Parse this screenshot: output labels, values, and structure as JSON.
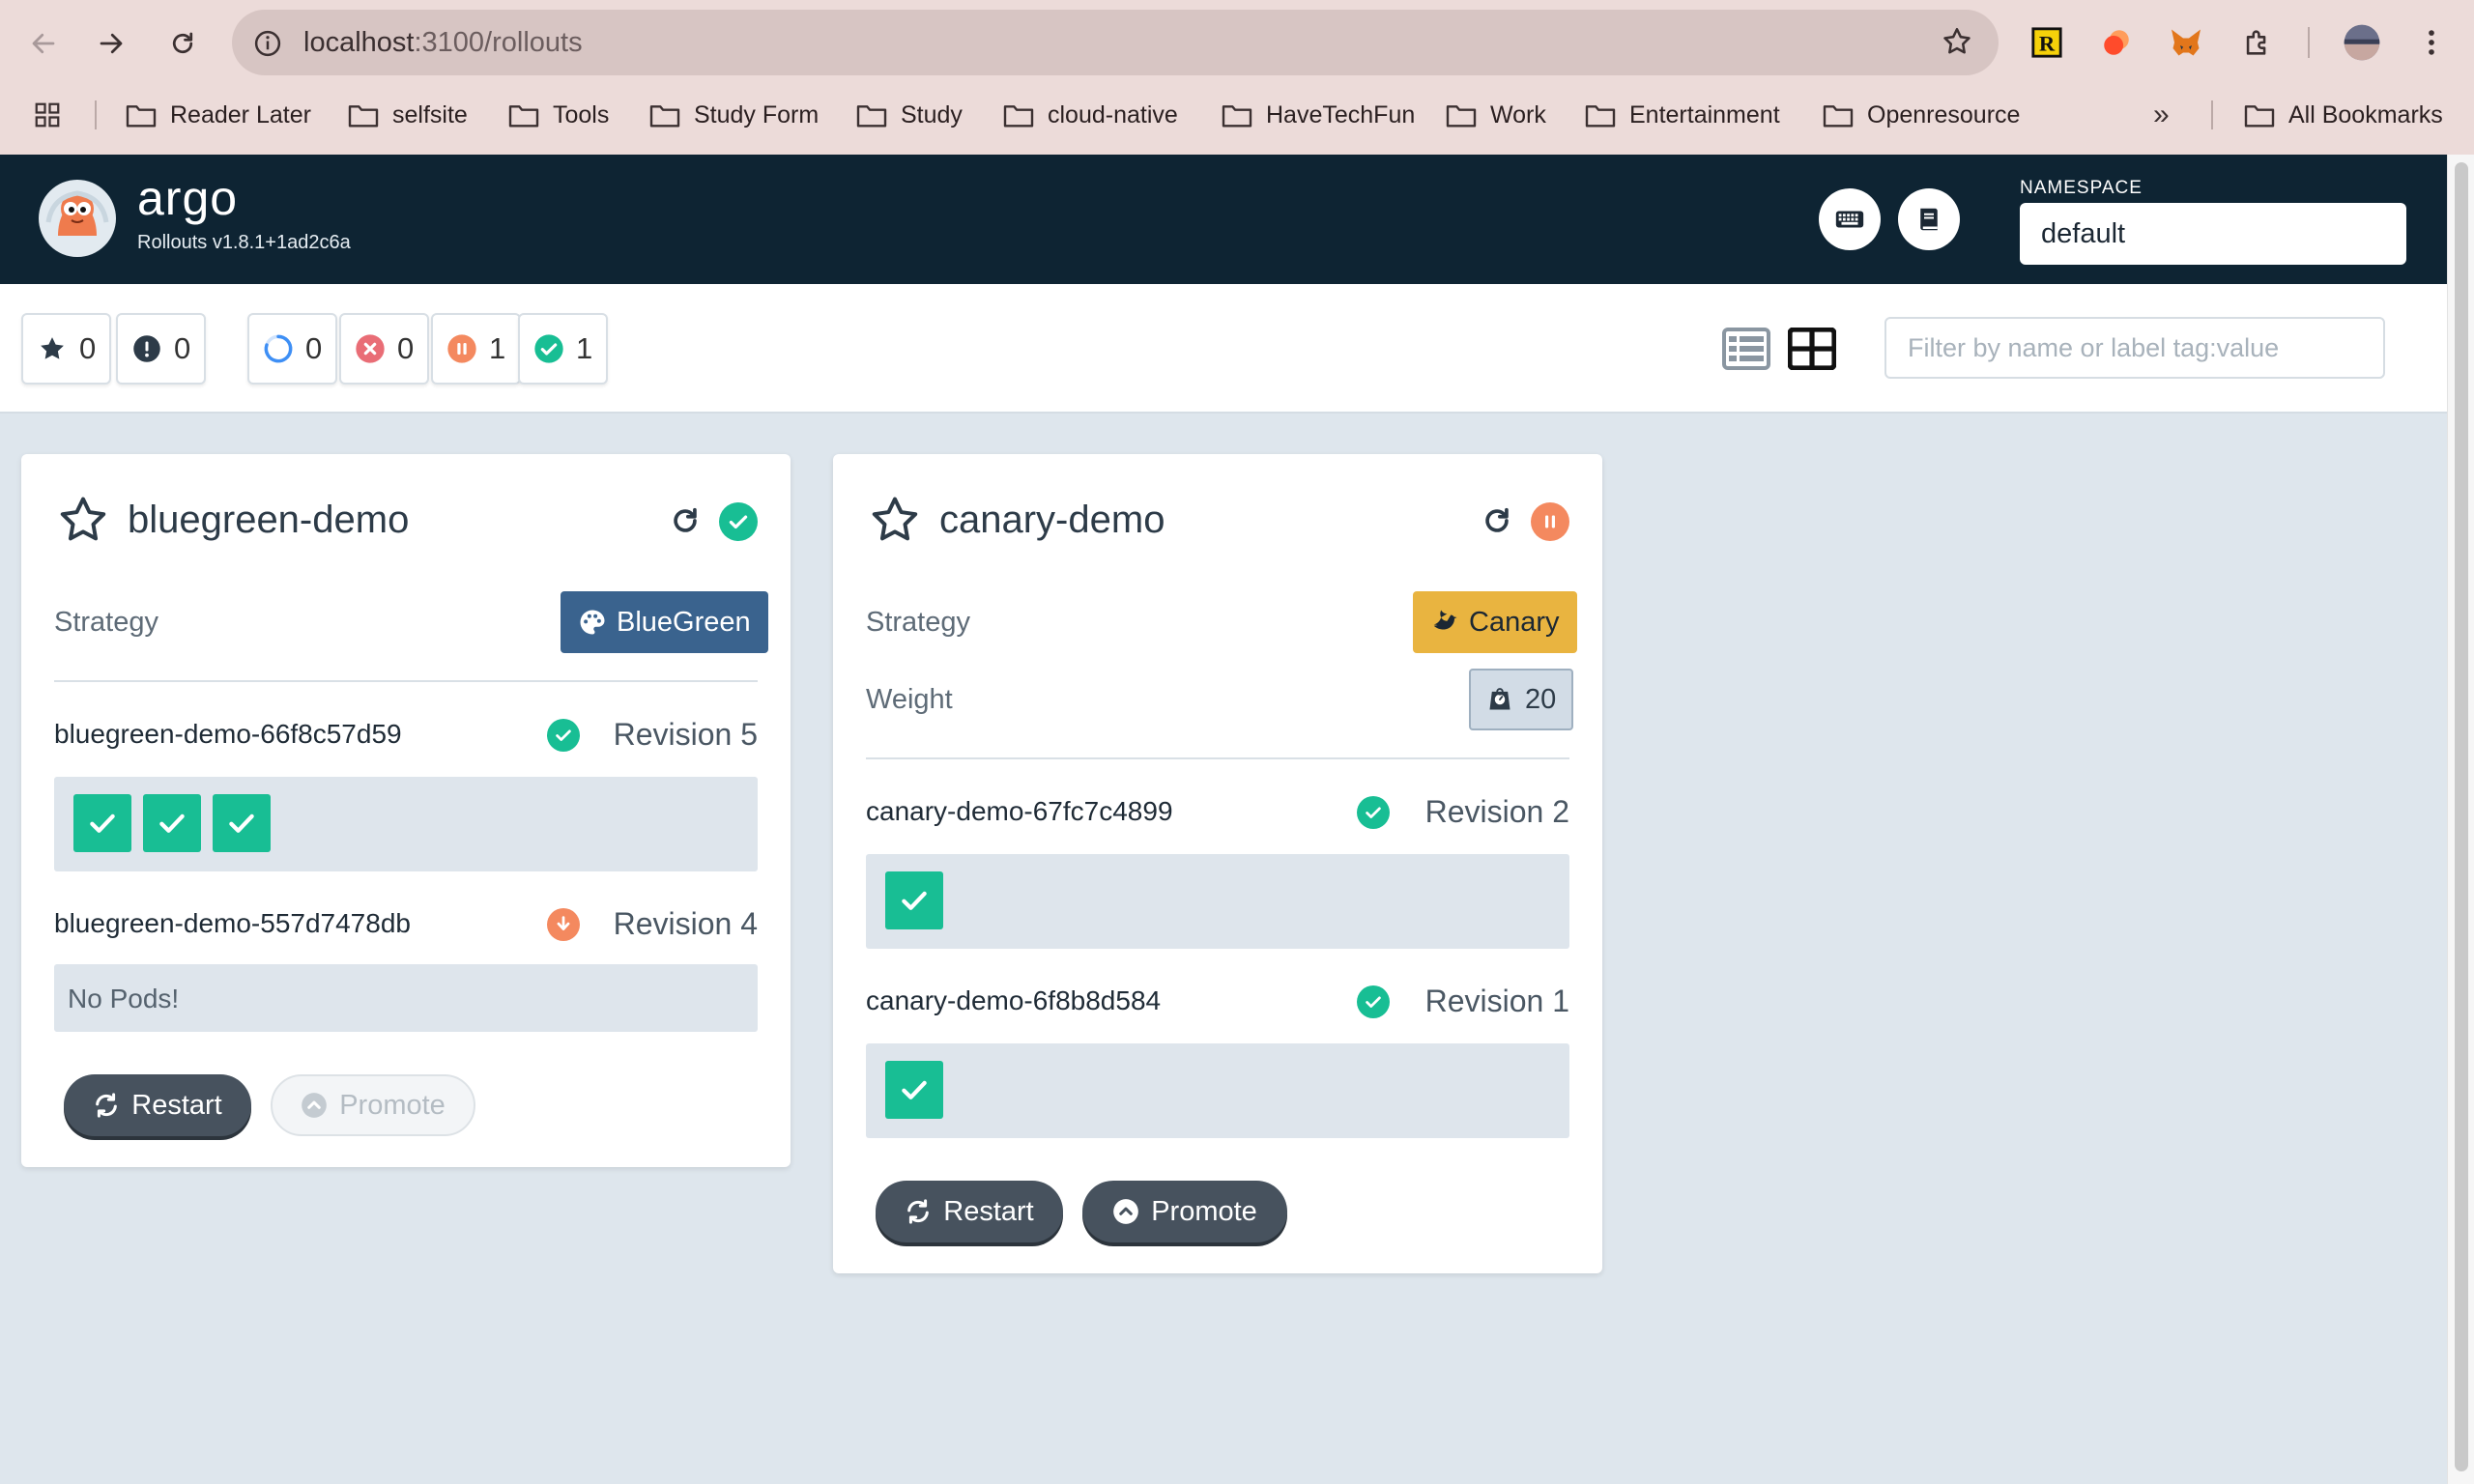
{
  "browser": {
    "url_host": "localhost",
    "url_path": ":3100/rollouts",
    "bookmarks": [
      {
        "label": "Reader Later"
      },
      {
        "label": "selfsite"
      },
      {
        "label": "Tools"
      },
      {
        "label": "Study Form"
      },
      {
        "label": "Study"
      },
      {
        "label": "cloud-native"
      },
      {
        "label": "HaveTechFun"
      },
      {
        "label": "Work"
      },
      {
        "label": "Entertainment"
      },
      {
        "label": "Openresource"
      }
    ],
    "more_bookmarks": "»",
    "all_bookmarks": "All Bookmarks"
  },
  "header": {
    "brand": "argo",
    "version": "Rollouts v1.8.1+1ad2c6a",
    "namespace_label": "NAMESPACE",
    "namespace_value": "default"
  },
  "toolbar": {
    "favorites_count": "0",
    "warnings_count": "0",
    "progressing_count": "0",
    "degraded_count": "0",
    "paused_count": "1",
    "healthy_count": "1",
    "filter_placeholder": "Filter by name or label tag:value"
  },
  "colors": {
    "header_bg": "#0e2433",
    "healthy": "#18be94",
    "paused": "#f4895f",
    "degraded": "#e96d76",
    "progressing": "#3e8ff5",
    "bluegreen": "#3a638e",
    "canary": "#e9b440"
  },
  "rollouts": [
    {
      "name": "bluegreen-demo",
      "status": "healthy",
      "strategy_label": "Strategy",
      "strategy": "BlueGreen",
      "replicasets": [
        {
          "name": "bluegreen-demo-66f8c57d59",
          "status": "healthy",
          "revision": "Revision 5",
          "pods": 3
        },
        {
          "name": "bluegreen-demo-557d7478db",
          "status": "scaled-down",
          "revision": "Revision 4",
          "pods": 0,
          "empty_text": "No Pods!"
        }
      ],
      "restart_label": "Restart",
      "promote_label": "Promote"
    },
    {
      "name": "canary-demo",
      "status": "paused",
      "strategy_label": "Strategy",
      "strategy": "Canary",
      "weight_label": "Weight",
      "weight": "20",
      "replicasets": [
        {
          "name": "canary-demo-67fc7c4899",
          "status": "healthy",
          "revision": "Revision 2",
          "pods": 1
        },
        {
          "name": "canary-demo-6f8b8d584",
          "status": "healthy",
          "revision": "Revision 1",
          "pods": 1
        }
      ],
      "restart_label": "Restart",
      "promote_label": "Promote"
    }
  ]
}
